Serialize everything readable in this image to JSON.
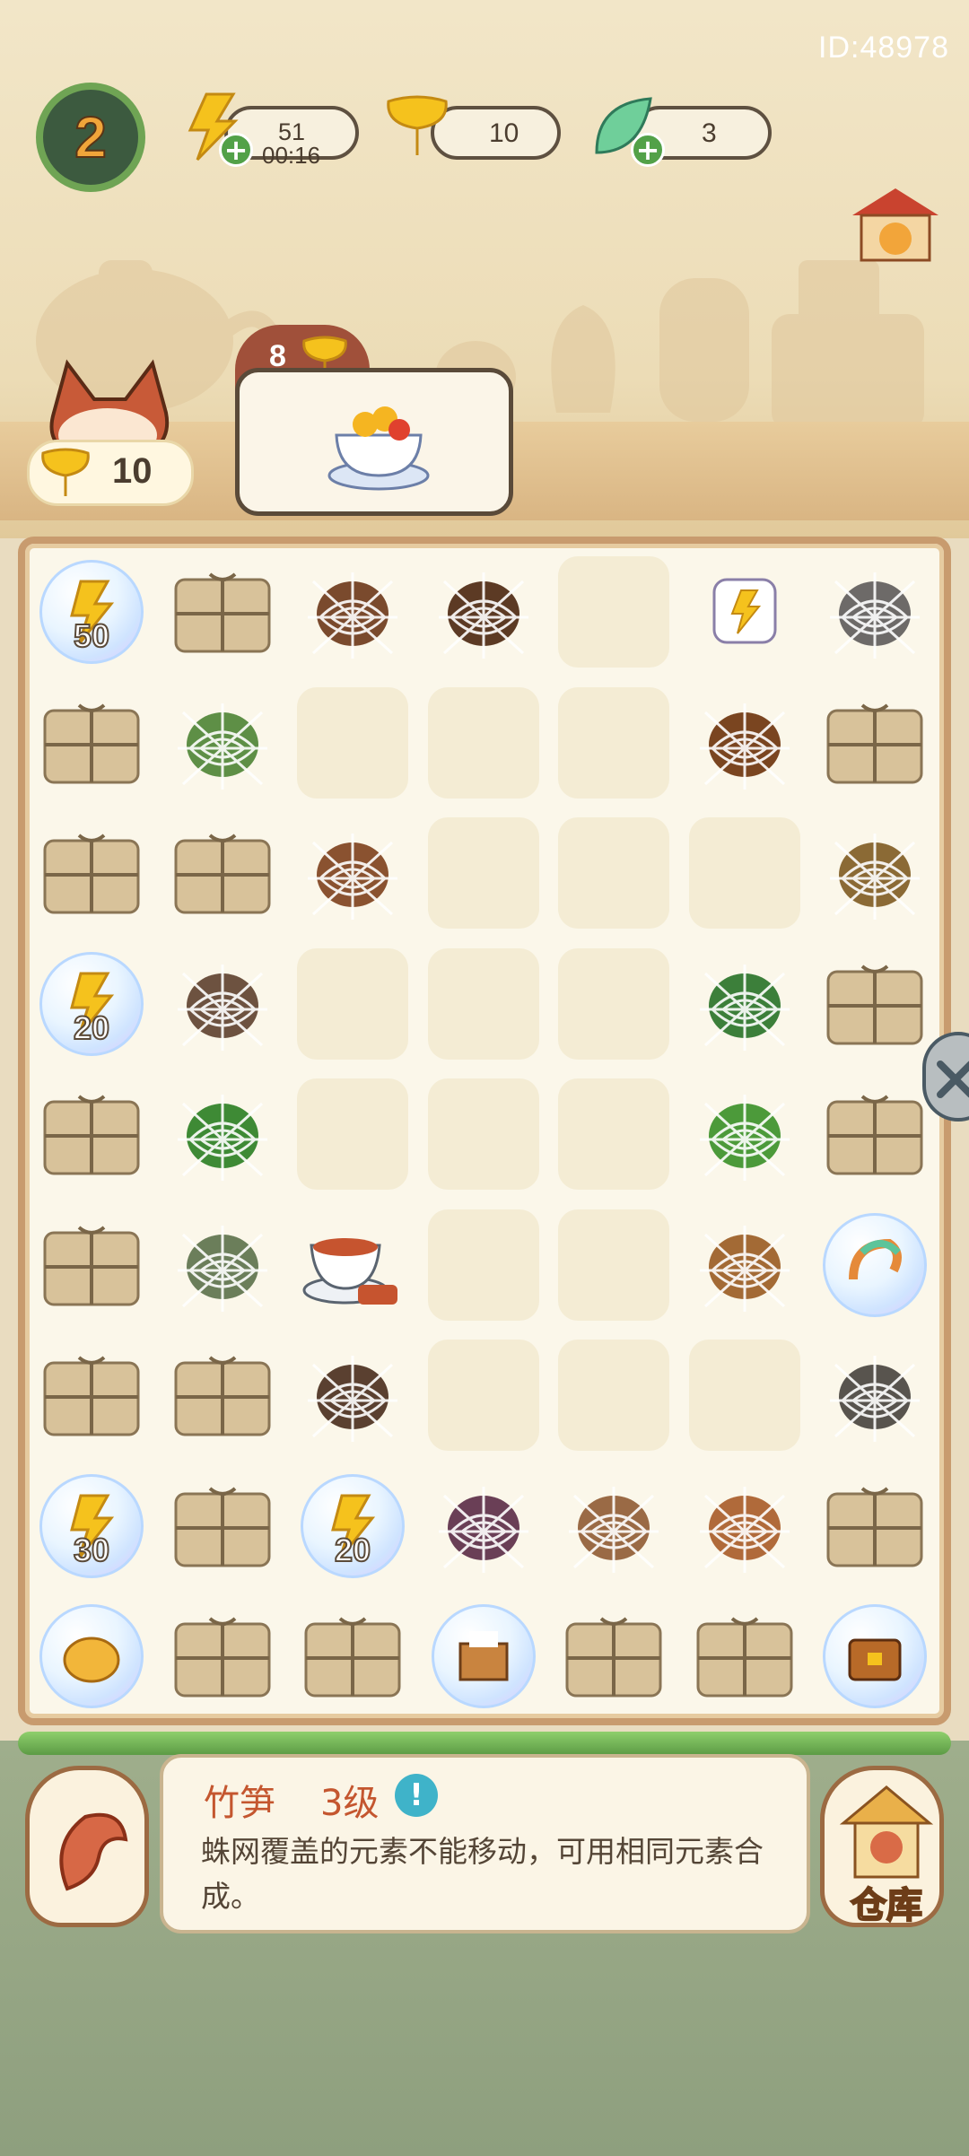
{
  "header": {
    "player_id": "ID:48978",
    "level": "2",
    "energy": {
      "value": "51",
      "timer": "00:16"
    },
    "ginkgo": {
      "value": "10"
    },
    "leaf": {
      "value": "3"
    }
  },
  "pet": {
    "coins": "10"
  },
  "order": {
    "reward": "8",
    "item_icon": "tea-bowl-with-flowers-icon"
  },
  "colors": {
    "accent": "#c4562f",
    "board_border": "#c89b6e",
    "energy": "#f5c21d",
    "green": "#52a148"
  },
  "board": {
    "rows": 9,
    "cols": 7,
    "cells": [
      [
        {
          "type": "bubble",
          "icon": "energy",
          "value": "50"
        },
        {
          "type": "box"
        },
        {
          "type": "web",
          "icon": "wood-log"
        },
        {
          "type": "web",
          "icon": "sprout"
        },
        {
          "type": "empty"
        },
        {
          "type": "item",
          "icon": "energy-card"
        },
        {
          "type": "web",
          "icon": "stone"
        }
      ],
      [
        {
          "type": "box"
        },
        {
          "type": "web",
          "icon": "green-cube"
        },
        {
          "type": "empty"
        },
        {
          "type": "empty"
        },
        {
          "type": "empty"
        },
        {
          "type": "web",
          "icon": "clay-pot"
        },
        {
          "type": "box"
        }
      ],
      [
        {
          "type": "box"
        },
        {
          "type": "box"
        },
        {
          "type": "web",
          "icon": "bamboo-shoot"
        },
        {
          "type": "empty"
        },
        {
          "type": "empty"
        },
        {
          "type": "empty"
        },
        {
          "type": "web",
          "icon": "soup-pot"
        }
      ],
      [
        {
          "type": "bubble",
          "icon": "energy",
          "value": "20"
        },
        {
          "type": "web",
          "icon": "mushroom"
        },
        {
          "type": "empty"
        },
        {
          "type": "empty"
        },
        {
          "type": "empty"
        },
        {
          "type": "web",
          "icon": "leaf"
        },
        {
          "type": "box"
        }
      ],
      [
        {
          "type": "box"
        },
        {
          "type": "web",
          "icon": "bamboo-leaf"
        },
        {
          "type": "empty"
        },
        {
          "type": "empty"
        },
        {
          "type": "empty"
        },
        {
          "type": "web",
          "icon": "tea-sprig"
        },
        {
          "type": "box"
        }
      ],
      [
        {
          "type": "box"
        },
        {
          "type": "web",
          "icon": "tea-leaves"
        },
        {
          "type": "item",
          "icon": "tea-cup"
        },
        {
          "type": "empty"
        },
        {
          "type": "empty"
        },
        {
          "type": "web",
          "icon": "gourd"
        },
        {
          "type": "bubble",
          "icon": "shrimp"
        }
      ],
      [
        {
          "type": "box"
        },
        {
          "type": "box"
        },
        {
          "type": "web",
          "icon": "nest"
        },
        {
          "type": "empty"
        },
        {
          "type": "empty"
        },
        {
          "type": "empty"
        },
        {
          "type": "web",
          "icon": "rock"
        }
      ],
      [
        {
          "type": "bubble",
          "icon": "energy",
          "value": "30"
        },
        {
          "type": "box"
        },
        {
          "type": "bubble",
          "icon": "energy",
          "value": "20"
        },
        {
          "type": "web",
          "icon": "purple-leaf"
        },
        {
          "type": "web",
          "icon": "clay-jar"
        },
        {
          "type": "web",
          "icon": "kettle"
        },
        {
          "type": "box"
        }
      ],
      [
        {
          "type": "bubble",
          "icon": "golden-pig"
        },
        {
          "type": "box"
        },
        {
          "type": "box"
        },
        {
          "type": "bubble",
          "icon": "gift-box"
        },
        {
          "type": "box"
        },
        {
          "type": "box"
        },
        {
          "type": "bubble",
          "icon": "treasure-chest"
        }
      ]
    ]
  },
  "info_panel": {
    "name": "竹笋",
    "level": "3级",
    "description": "蛛网覆盖的元素不能移动，可用相同元素合成。",
    "info_icon": "!"
  },
  "warehouse": {
    "label": "仓库"
  }
}
